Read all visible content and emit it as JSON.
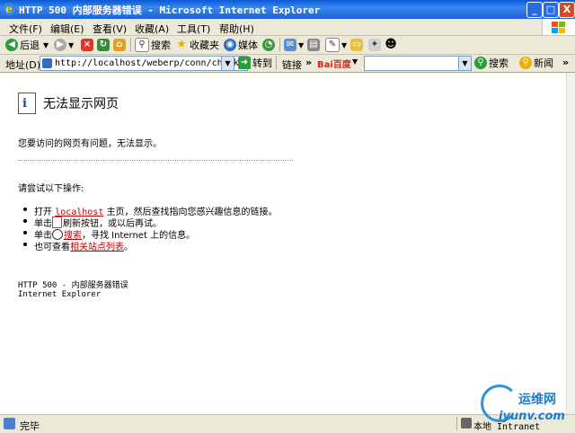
{
  "window": {
    "title": "HTTP 500 内部服务器错误 - Microsoft Internet Explorer",
    "minimize": "_",
    "maximize": "□",
    "close": "X"
  },
  "menu": {
    "items": [
      "文件(F)",
      "编辑(E)",
      "查看(V)",
      "收藏(A)",
      "工具(T)",
      "帮助(H)"
    ]
  },
  "toolbar": {
    "back": "后退",
    "search": "搜索",
    "favorites": "收藏夹",
    "media": "媒体"
  },
  "address": {
    "label": "地址(D)",
    "url": "http://localhost/weberp/conn/checkdata",
    "go": "转到",
    "links": "链接",
    "more": "»",
    "baidu_logo": "Bai百度",
    "search_btn": "搜索",
    "news_btn": "新闻"
  },
  "page": {
    "heading": "无法显示网页",
    "message": "您要访问的网页有问题，无法显示。",
    "try_heading": "请尝试以下操作:",
    "item1_pre": "打开 ",
    "item1_link": "localhost",
    "item1_post": " 主页，然后查找指向您感兴趣信息的链接。",
    "item2_pre": "单击",
    "item2_post": "刷新按钮，或以后再试。",
    "item3_pre": "单击",
    "item3_link": "搜索",
    "item3_post": "，寻找 Internet 上的信息。",
    "item4_pre": "也可查看",
    "item4_link": "相关站点列表",
    "item4_post": "。",
    "footer_error": "HTTP 500 - 内部服务器错误",
    "footer_app": "Internet Explorer"
  },
  "status": {
    "text": "完毕",
    "zone": "本地 Intranet"
  },
  "watermark": {
    "cn": "运维网",
    "url": "iyunv.com"
  },
  "colors": {
    "titlebar": "#0a5ad6",
    "link": "#c00000",
    "chrome": "#ece9d8"
  }
}
